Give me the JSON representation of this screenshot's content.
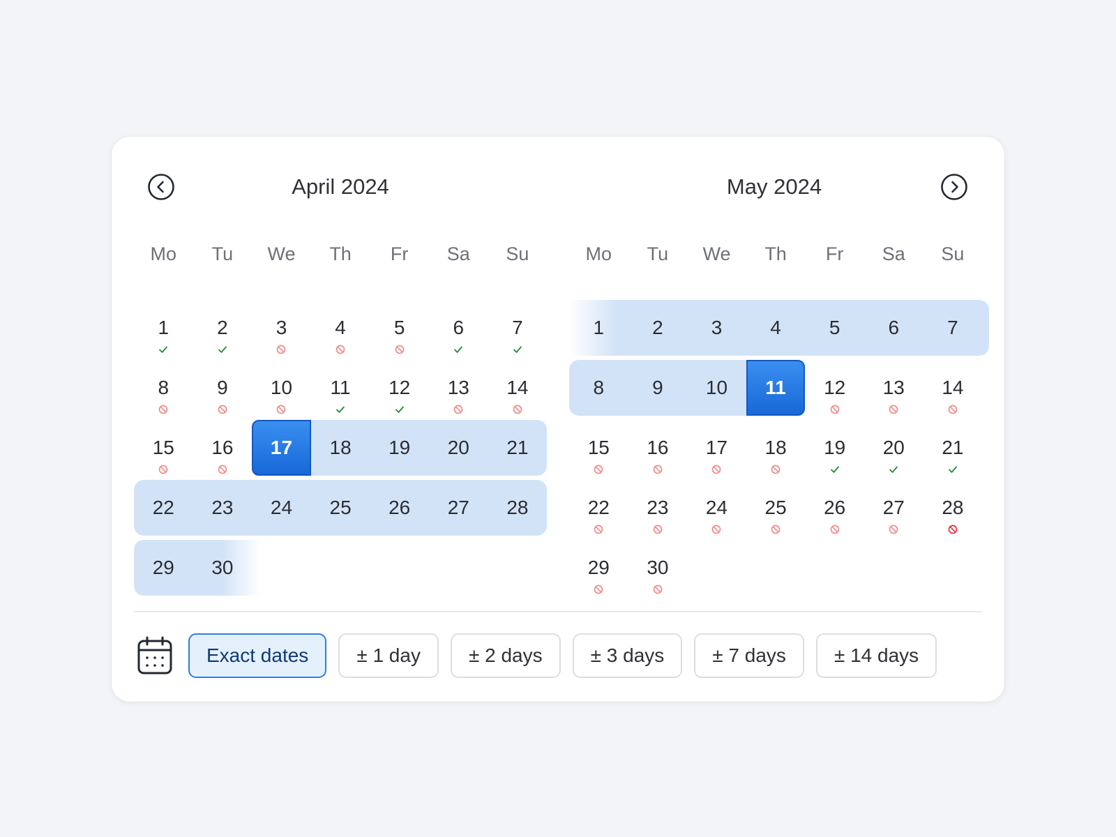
{
  "nav": {
    "prev_icon": "chevron-left-circle-icon",
    "next_icon": "chevron-right-circle-icon"
  },
  "months": [
    {
      "title": "April 2024",
      "weekdays": [
        "Mo",
        "Tu",
        "We",
        "Th",
        "Fr",
        "Sa",
        "Su"
      ],
      "start_offset": 0,
      "days": [
        {
          "d": "1",
          "status": "available"
        },
        {
          "d": "2",
          "status": "available"
        },
        {
          "d": "3",
          "status": "unavailable"
        },
        {
          "d": "4",
          "status": "unavailable"
        },
        {
          "d": "5",
          "status": "unavailable"
        },
        {
          "d": "6",
          "status": "available"
        },
        {
          "d": "7",
          "status": "available"
        },
        {
          "d": "8",
          "status": "unavailable"
        },
        {
          "d": "9",
          "status": "unavailable"
        },
        {
          "d": "10",
          "status": "unavailable"
        },
        {
          "d": "11",
          "status": "available"
        },
        {
          "d": "12",
          "status": "available"
        },
        {
          "d": "13",
          "status": "unavailable"
        },
        {
          "d": "14",
          "status": "unavailable"
        },
        {
          "d": "15",
          "status": "unavailable"
        },
        {
          "d": "16",
          "status": "unavailable"
        },
        {
          "d": "17",
          "status": "selected-start"
        },
        {
          "d": "18",
          "status": "in-range"
        },
        {
          "d": "19",
          "status": "in-range"
        },
        {
          "d": "20",
          "status": "in-range"
        },
        {
          "d": "21",
          "status": "in-range"
        },
        {
          "d": "22",
          "status": "in-range"
        },
        {
          "d": "23",
          "status": "in-range"
        },
        {
          "d": "24",
          "status": "in-range"
        },
        {
          "d": "25",
          "status": "in-range"
        },
        {
          "d": "26",
          "status": "in-range"
        },
        {
          "d": "27",
          "status": "in-range"
        },
        {
          "d": "28",
          "status": "in-range"
        },
        {
          "d": "29",
          "status": "in-range"
        },
        {
          "d": "30",
          "status": "in-range"
        }
      ]
    },
    {
      "title": "May 2024",
      "weekdays": [
        "Mo",
        "Tu",
        "We",
        "Th",
        "Fr",
        "Sa",
        "Su"
      ],
      "start_offset": 0,
      "days": [
        {
          "d": "1",
          "status": "in-range"
        },
        {
          "d": "2",
          "status": "in-range"
        },
        {
          "d": "3",
          "status": "in-range"
        },
        {
          "d": "4",
          "status": "in-range"
        },
        {
          "d": "5",
          "status": "in-range"
        },
        {
          "d": "6",
          "status": "in-range"
        },
        {
          "d": "7",
          "status": "in-range"
        },
        {
          "d": "8",
          "status": "in-range"
        },
        {
          "d": "9",
          "status": "in-range"
        },
        {
          "d": "10",
          "status": "in-range"
        },
        {
          "d": "11",
          "status": "selected-end"
        },
        {
          "d": "12",
          "status": "unavailable"
        },
        {
          "d": "13",
          "status": "unavailable"
        },
        {
          "d": "14",
          "status": "unavailable"
        },
        {
          "d": "15",
          "status": "unavailable"
        },
        {
          "d": "16",
          "status": "unavailable"
        },
        {
          "d": "17",
          "status": "unavailable"
        },
        {
          "d": "18",
          "status": "unavailable"
        },
        {
          "d": "19",
          "status": "available"
        },
        {
          "d": "20",
          "status": "available"
        },
        {
          "d": "21",
          "status": "available"
        },
        {
          "d": "22",
          "status": "unavailable"
        },
        {
          "d": "23",
          "status": "unavailable"
        },
        {
          "d": "24",
          "status": "unavailable"
        },
        {
          "d": "25",
          "status": "unavailable"
        },
        {
          "d": "26",
          "status": "unavailable"
        },
        {
          "d": "27",
          "status": "unavailable"
        },
        {
          "d": "28",
          "status": "unavailable-strong"
        },
        {
          "d": "29",
          "status": "unavailable"
        },
        {
          "d": "30",
          "status": "unavailable"
        }
      ]
    }
  ],
  "footer": {
    "icon": "calendar-icon",
    "options": [
      {
        "label": "Exact dates",
        "active": true
      },
      {
        "label": "± 1 day",
        "active": false
      },
      {
        "label": "± 2 days",
        "active": false
      },
      {
        "label": "± 3 days",
        "active": false
      },
      {
        "label": "± 7 days",
        "active": false
      },
      {
        "label": "± 14 days",
        "active": false
      }
    ]
  },
  "colors": {
    "range": "#d3e3f7",
    "selected": "#1868d8",
    "available": "#1f8a3a",
    "unavailable": "#f08a8a",
    "unavailable_strong": "#e0303a",
    "active_button_bg": "#e5f0fd",
    "active_button_border": "#2f7de0"
  }
}
